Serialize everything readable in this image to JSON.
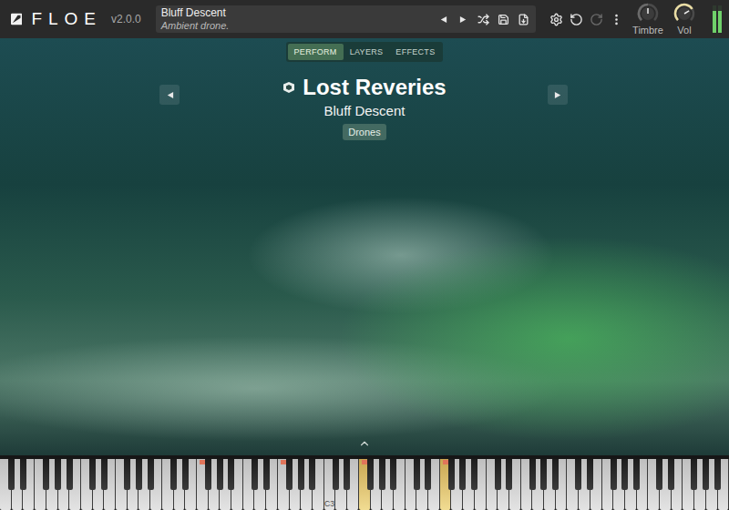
{
  "app": {
    "name": "FLOE",
    "version": "v2.0.0"
  },
  "preset": {
    "name": "Bluff Descent",
    "description": "Ambient drone."
  },
  "toolbar": [
    {
      "kind": "settings",
      "disabled": false
    },
    {
      "kind": "undo",
      "disabled": false
    },
    {
      "kind": "redo",
      "disabled": true
    },
    {
      "kind": "menu",
      "disabled": false
    }
  ],
  "knobs": [
    {
      "label": "Timbre",
      "level": 0.5,
      "color": "#6a6a6a"
    },
    {
      "label": "Vol",
      "level": 0.72,
      "color": "#e9dca4"
    }
  ],
  "meter": {
    "levels": [
      0.8,
      0.8
    ]
  },
  "tabs": [
    {
      "label": "PERFORM",
      "selected": true
    },
    {
      "label": "LAYERS",
      "selected": false
    },
    {
      "label": "EFFECTS",
      "selected": false
    }
  ],
  "instrument": {
    "library": "Lost Reveries",
    "preset": "Bluff Descent",
    "tags": [
      "Drones"
    ]
  },
  "keyboard": {
    "octaves": [
      {
        "label": "",
        "keys": [
          {
            "pressed": false,
            "marked": false
          },
          {
            "pressed": false,
            "marked": false
          },
          {
            "pressed": false,
            "marked": false
          },
          {
            "pressed": false,
            "marked": false
          },
          {
            "pressed": false,
            "marked": false
          },
          {
            "pressed": false,
            "marked": false
          },
          {
            "pressed": false,
            "marked": false
          },
          {
            "pressed": false,
            "marked": false
          },
          {
            "pressed": false,
            "marked": false
          },
          {
            "pressed": false,
            "marked": false
          },
          {
            "pressed": false,
            "marked": false
          },
          {
            "pressed": false,
            "marked": false
          }
        ]
      },
      {
        "label": "",
        "keys": [
          {
            "pressed": false,
            "marked": false
          },
          {
            "pressed": false,
            "marked": false
          },
          {
            "pressed": false,
            "marked": false
          },
          {
            "pressed": false,
            "marked": false
          },
          {
            "pressed": false,
            "marked": false
          },
          {
            "pressed": false,
            "marked": false
          },
          {
            "pressed": false,
            "marked": false
          },
          {
            "pressed": false,
            "marked": false
          },
          {
            "pressed": false,
            "marked": false
          },
          {
            "pressed": false,
            "marked": false
          },
          {
            "pressed": false,
            "marked": false
          },
          {
            "pressed": false,
            "marked": false
          }
        ]
      },
      {
        "label": "",
        "keys": [
          {
            "pressed": false,
            "marked": false
          },
          {
            "pressed": false,
            "marked": false
          },
          {
            "pressed": false,
            "marked": false
          },
          {
            "pressed": false,
            "marked": false
          },
          {
            "pressed": false,
            "marked": false
          },
          {
            "pressed": false,
            "marked": true
          },
          {
            "pressed": false,
            "marked": false
          },
          {
            "pressed": false,
            "marked": false
          },
          {
            "pressed": false,
            "marked": false
          },
          {
            "pressed": false,
            "marked": false
          },
          {
            "pressed": false,
            "marked": false
          },
          {
            "pressed": false,
            "marked": false
          }
        ]
      },
      {
        "label": "",
        "keys": [
          {
            "pressed": false,
            "marked": false
          },
          {
            "pressed": false,
            "marked": false
          },
          {
            "pressed": false,
            "marked": false
          },
          {
            "pressed": false,
            "marked": false
          },
          {
            "pressed": false,
            "marked": false
          },
          {
            "pressed": false,
            "marked": true
          },
          {
            "pressed": false,
            "marked": false
          },
          {
            "pressed": false,
            "marked": false
          },
          {
            "pressed": false,
            "marked": false
          },
          {
            "pressed": false,
            "marked": false
          },
          {
            "pressed": false,
            "marked": false
          },
          {
            "pressed": false,
            "marked": false
          }
        ]
      },
      {
        "label": "C3",
        "keys": [
          {
            "pressed": false,
            "marked": false
          },
          {
            "pressed": false,
            "marked": false
          },
          {
            "pressed": false,
            "marked": false
          },
          {
            "pressed": false,
            "marked": false
          },
          {
            "pressed": false,
            "marked": false
          },
          {
            "pressed": true,
            "marked": true
          },
          {
            "pressed": false,
            "marked": false
          },
          {
            "pressed": false,
            "marked": false
          },
          {
            "pressed": false,
            "marked": false
          },
          {
            "pressed": false,
            "marked": false
          },
          {
            "pressed": false,
            "marked": false
          },
          {
            "pressed": false,
            "marked": false
          }
        ]
      },
      {
        "label": "",
        "keys": [
          {
            "pressed": false,
            "marked": false
          },
          {
            "pressed": false,
            "marked": false
          },
          {
            "pressed": false,
            "marked": false
          },
          {
            "pressed": false,
            "marked": false
          },
          {
            "pressed": false,
            "marked": false
          },
          {
            "pressed": true,
            "marked": true
          },
          {
            "pressed": false,
            "marked": false
          },
          {
            "pressed": false,
            "marked": false
          },
          {
            "pressed": false,
            "marked": false
          },
          {
            "pressed": false,
            "marked": false
          },
          {
            "pressed": false,
            "marked": false
          },
          {
            "pressed": false,
            "marked": false
          }
        ]
      },
      {
        "label": "",
        "keys": [
          {
            "pressed": false,
            "marked": false
          },
          {
            "pressed": false,
            "marked": false
          },
          {
            "pressed": false,
            "marked": false
          },
          {
            "pressed": false,
            "marked": false
          },
          {
            "pressed": false,
            "marked": false
          },
          {
            "pressed": false,
            "marked": false
          },
          {
            "pressed": false,
            "marked": false
          },
          {
            "pressed": false,
            "marked": false
          },
          {
            "pressed": false,
            "marked": false
          },
          {
            "pressed": false,
            "marked": false
          },
          {
            "pressed": false,
            "marked": false
          },
          {
            "pressed": false,
            "marked": false
          }
        ]
      },
      {
        "label": "",
        "keys": [
          {
            "pressed": false,
            "marked": false
          },
          {
            "pressed": false,
            "marked": false
          },
          {
            "pressed": false,
            "marked": false
          },
          {
            "pressed": false,
            "marked": false
          },
          {
            "pressed": false,
            "marked": false
          },
          {
            "pressed": false,
            "marked": false
          },
          {
            "pressed": false,
            "marked": false
          },
          {
            "pressed": false,
            "marked": false
          },
          {
            "pressed": false,
            "marked": false
          },
          {
            "pressed": false,
            "marked": false
          },
          {
            "pressed": false,
            "marked": false
          },
          {
            "pressed": false,
            "marked": false
          }
        ]
      },
      {
        "label": "",
        "keys": [
          {
            "pressed": false,
            "marked": false
          },
          {
            "pressed": false,
            "marked": false
          },
          {
            "pressed": false,
            "marked": false
          },
          {
            "pressed": false,
            "marked": false
          },
          {
            "pressed": false,
            "marked": false
          },
          {
            "pressed": false,
            "marked": false
          },
          {
            "pressed": false,
            "marked": false
          },
          {
            "pressed": false,
            "marked": false
          },
          {
            "pressed": false,
            "marked": false
          },
          {
            "pressed": false,
            "marked": false
          },
          {
            "pressed": false,
            "marked": false
          },
          {
            "pressed": false,
            "marked": false
          }
        ]
      }
    ]
  }
}
